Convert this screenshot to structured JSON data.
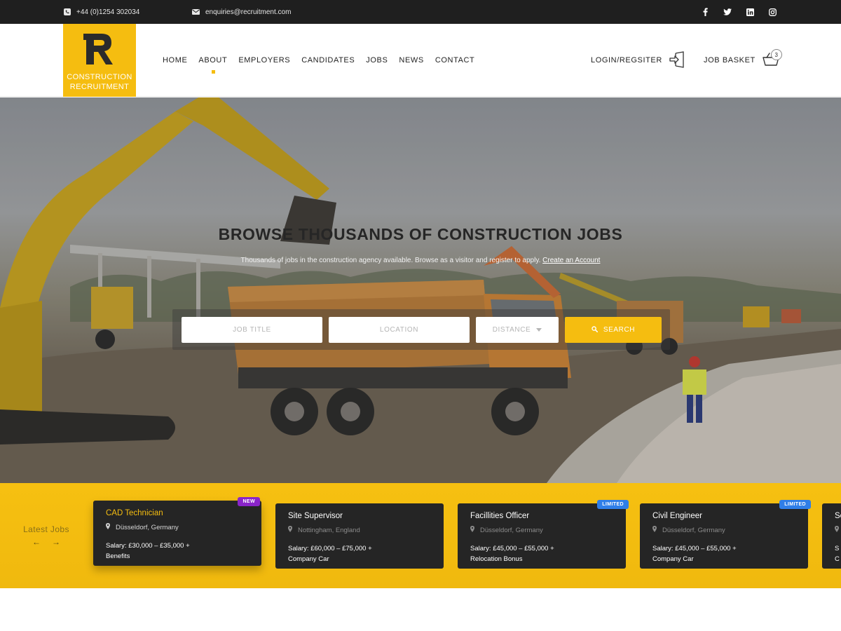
{
  "topbar": {
    "phone": "+44 (0)1254 302034",
    "email": "enquiries@recruitment.com",
    "socials": [
      "facebook-icon",
      "twitter-icon",
      "linkedin-icon",
      "instagram-icon"
    ]
  },
  "brand": {
    "mark": "R",
    "line1": "CONSTRUCTION",
    "line2": "RECRUITMENT",
    "accent": "#f5bd10"
  },
  "nav": {
    "items": [
      {
        "label": "HOME",
        "active": false
      },
      {
        "label": "ABOUT",
        "active": true
      },
      {
        "label": "EMPLOYERS",
        "active": false
      },
      {
        "label": "CANDIDATES",
        "active": false
      },
      {
        "label": "JOBS",
        "active": false
      },
      {
        "label": "NEWS",
        "active": false
      },
      {
        "label": "CONTACT",
        "active": false
      }
    ],
    "login_label": "LOGIN/REGSITER",
    "basket_label": "JOB BASKET",
    "basket_count": "3"
  },
  "hero": {
    "title": "BROWSE THOUSANDS OF CONSTRUCTION JOBS",
    "subtitle": "Thousands of jobs in the construction agency available. Browse as a visitor and register to apply.",
    "subtitle_link": "Create an Account"
  },
  "search": {
    "job_title_placeholder": "JOB TITLE",
    "location_placeholder": "LOCATION",
    "distance_label": "DISTANCE",
    "button_label": "SEARCH"
  },
  "jobs": {
    "heading": "Latest Jobs",
    "prev": "←",
    "next": "→",
    "cards": [
      {
        "title": "CAD Technician",
        "location": "Düsseldorf, Germany",
        "salary_line1": "Salary: £30,000 – £35,000 +",
        "salary_line2": "Benefits",
        "badge": "NEW"
      },
      {
        "title": "Site Supervisor",
        "location": "Nottingham, England",
        "salary_line1": "Salary: £60,000 – £75,000 +",
        "salary_line2": "Company Car",
        "badge": ""
      },
      {
        "title": "Facillities Officer",
        "location": "Düsseldorf, Germany",
        "salary_line1": "Salary: £45,000 – £55,000 +",
        "salary_line2": "Relocation Bonus",
        "badge": "LIMITED"
      },
      {
        "title": "Civil Engineer",
        "location": "Düsseldorf, Germany",
        "salary_line1": "Salary: £45,000 – £55,000 +",
        "salary_line2": "Company Car",
        "badge": "LIMITED"
      },
      {
        "title": "Se",
        "location": "",
        "salary_line1": "S",
        "salary_line2": "C",
        "badge": ""
      }
    ]
  },
  "colors": {
    "accent": "#f5bd10",
    "dark": "#1f1f1f",
    "card": "#252525",
    "badge_new": "#8a24c9",
    "badge_limited": "#2f7ee8"
  }
}
